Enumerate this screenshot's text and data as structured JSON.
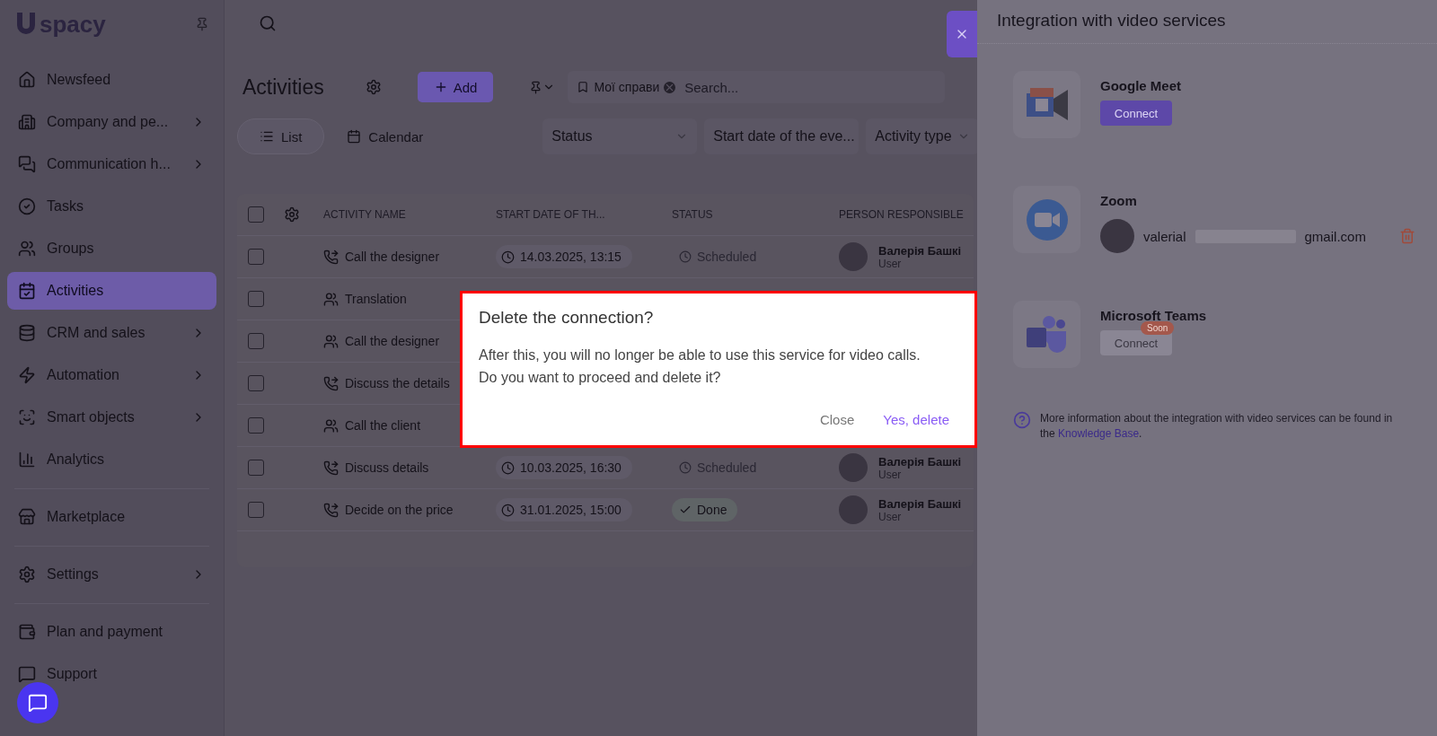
{
  "sidebar": {
    "logo_text": "spacy",
    "items": [
      {
        "label": "Newsfeed",
        "expandable": false,
        "selected": false
      },
      {
        "label": "Company and pe...",
        "expandable": true,
        "selected": false
      },
      {
        "label": "Communication h...",
        "expandable": true,
        "selected": false
      },
      {
        "label": "Tasks",
        "expandable": false,
        "selected": false
      },
      {
        "label": "Groups",
        "expandable": false,
        "selected": false
      },
      {
        "label": "Activities",
        "expandable": false,
        "selected": true
      },
      {
        "label": "CRM and sales",
        "expandable": true,
        "selected": false
      },
      {
        "label": "Automation",
        "expandable": true,
        "selected": false
      },
      {
        "label": "Smart objects",
        "expandable": true,
        "selected": false
      },
      {
        "label": "Analytics",
        "expandable": false,
        "selected": false
      },
      {
        "label": "Marketplace",
        "expandable": false,
        "selected": false
      },
      {
        "label": "Settings",
        "expandable": true,
        "selected": false
      },
      {
        "label": "Plan and payment",
        "expandable": false,
        "selected": false
      },
      {
        "label": "Support",
        "expandable": false,
        "selected": false
      }
    ]
  },
  "page": {
    "title": "Activities",
    "add_button": "Add",
    "filter_chip": "Мої справи",
    "search": {
      "placeholder": "Search..."
    },
    "views": [
      {
        "label": "List",
        "selected": true
      },
      {
        "label": "Calendar",
        "selected": false
      }
    ],
    "filters": [
      "Status",
      "Start date of the eve...",
      "Activity type"
    ]
  },
  "table": {
    "all_checked": false,
    "columns": [
      "ACTIVITY NAME",
      "START DATE OF TH...",
      "STATUS",
      "PERSON RESPONSIBLE"
    ],
    "rows": [
      {
        "kind": "call",
        "checked": false,
        "name": "Call the designer",
        "date": "14.03.2025, 13:15",
        "status": {
          "kind": "scheduled",
          "label": "Scheduled"
        },
        "person": "Валерія Башкі",
        "role": "User"
      },
      {
        "kind": "meeting",
        "checked": false,
        "name": "Translation"
      },
      {
        "kind": "meeting",
        "checked": false,
        "name": "Call the designer"
      },
      {
        "kind": "call",
        "checked": false,
        "name": "Discuss the details"
      },
      {
        "kind": "meeting",
        "checked": false,
        "name": "Call the client"
      },
      {
        "kind": "call",
        "checked": false,
        "name": "Discuss details",
        "date": "10.03.2025, 16:30",
        "status": {
          "kind": "scheduled",
          "label": "Scheduled"
        },
        "person": "Валерія Башкі",
        "role": "User"
      },
      {
        "kind": "call",
        "checked": false,
        "name": "Decide on the price",
        "date": "31.01.2025, 15:00",
        "status": {
          "kind": "done",
          "label": "Done"
        },
        "person": "Валерія Башкі",
        "role": "User"
      }
    ]
  },
  "panel": {
    "title": "Integration with video services",
    "services": [
      {
        "kind": "meet",
        "name": "Google Meet",
        "button": "Connect",
        "disabled": false
      },
      {
        "kind": "zoom",
        "name": "Zoom",
        "account": {
          "email_start": "valerial",
          "email_end": "gmail.com"
        }
      },
      {
        "kind": "teams",
        "name": "Microsoft Teams",
        "button": "Connect",
        "disabled": true,
        "badge": "Soon"
      }
    ],
    "info": {
      "text": "More information about the integration with video services can be found in the",
      "link": "Knowledge Base",
      "end": "."
    }
  },
  "dialog": {
    "title": "Delete the connection?",
    "body": [
      "After this, you will no longer be able to use this service for video calls.",
      "Do you want to proceed and delete it?"
    ],
    "cancel": "Close",
    "confirm": "Yes, delete"
  }
}
